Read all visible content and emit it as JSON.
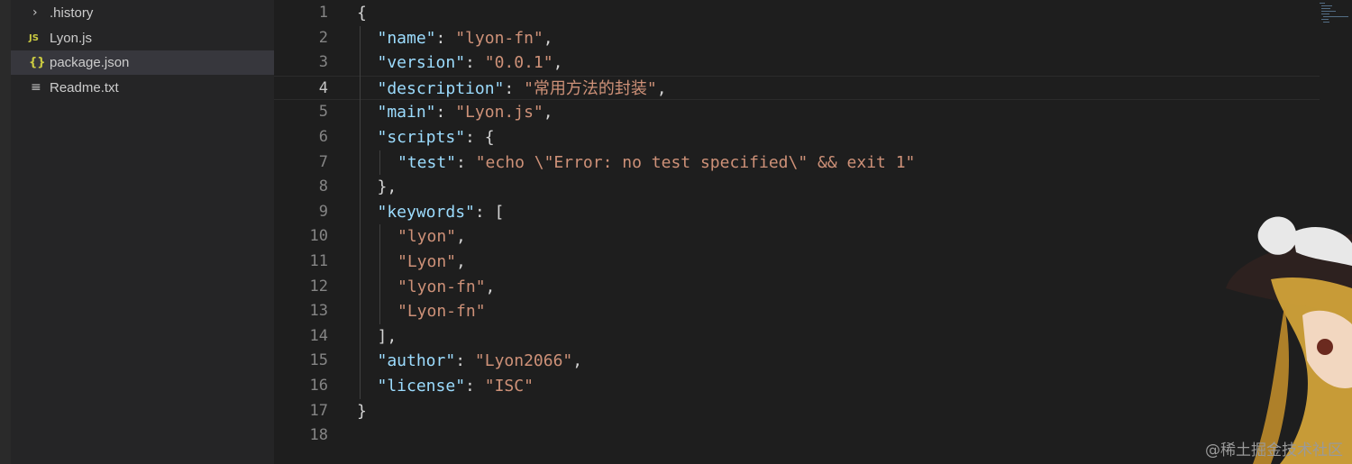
{
  "explorer": {
    "items": [
      {
        "label": ".history",
        "icon": "chevron-right-icon"
      },
      {
        "label": "Lyon.js",
        "icon": "javascript-file-icon",
        "badge": "JS"
      },
      {
        "label": "package.json",
        "icon": "json-file-icon",
        "badge": "{}"
      },
      {
        "label": "Readme.txt",
        "icon": "text-file-icon",
        "badge": "≡"
      }
    ],
    "selected": "package.json"
  },
  "editor": {
    "language": "json",
    "current_line": 4,
    "line_numbers": [
      "1",
      "2",
      "3",
      "4",
      "5",
      "6",
      "7",
      "8",
      "9",
      "10",
      "11",
      "12",
      "13",
      "14",
      "15",
      "16",
      "17",
      "18"
    ],
    "lines": [
      [
        {
          "t": "p",
          "v": "{"
        }
      ],
      [
        {
          "t": "k",
          "v": "\"name\""
        },
        {
          "t": "p",
          "v": ": "
        },
        {
          "t": "s",
          "v": "\"lyon-fn\""
        },
        {
          "t": "p",
          "v": ","
        }
      ],
      [
        {
          "t": "k",
          "v": "\"version\""
        },
        {
          "t": "p",
          "v": ": "
        },
        {
          "t": "s",
          "v": "\"0.0.1\""
        },
        {
          "t": "p",
          "v": ","
        }
      ],
      [
        {
          "t": "k",
          "v": "\"description\""
        },
        {
          "t": "p",
          "v": ": "
        },
        {
          "t": "s",
          "v": "\"常用方法的封装\""
        },
        {
          "t": "p",
          "v": ","
        }
      ],
      [
        {
          "t": "k",
          "v": "\"main\""
        },
        {
          "t": "p",
          "v": ": "
        },
        {
          "t": "s",
          "v": "\"Lyon.js\""
        },
        {
          "t": "p",
          "v": ","
        }
      ],
      [
        {
          "t": "k",
          "v": "\"scripts\""
        },
        {
          "t": "p",
          "v": ": {"
        }
      ],
      [
        {
          "t": "k",
          "v": "\"test\""
        },
        {
          "t": "p",
          "v": ": "
        },
        {
          "t": "s",
          "v": "\"echo \\\"Error: no test specified\\\" && exit 1\""
        }
      ],
      [
        {
          "t": "p",
          "v": "},"
        }
      ],
      [
        {
          "t": "k",
          "v": "\"keywords\""
        },
        {
          "t": "p",
          "v": ": ["
        }
      ],
      [
        {
          "t": "s",
          "v": "\"lyon\""
        },
        {
          "t": "p",
          "v": ","
        }
      ],
      [
        {
          "t": "s",
          "v": "\"Lyon\""
        },
        {
          "t": "p",
          "v": ","
        }
      ],
      [
        {
          "t": "s",
          "v": "\"lyon-fn\""
        },
        {
          "t": "p",
          "v": ","
        }
      ],
      [
        {
          "t": "s",
          "v": "\"Lyon-fn\""
        }
      ],
      [
        {
          "t": "p",
          "v": "],"
        }
      ],
      [
        {
          "t": "k",
          "v": "\"author\""
        },
        {
          "t": "p",
          "v": ": "
        },
        {
          "t": "s",
          "v": "\"Lyon2066\""
        },
        {
          "t": "p",
          "v": ","
        }
      ],
      [
        {
          "t": "k",
          "v": "\"license\""
        },
        {
          "t": "p",
          "v": ": "
        },
        {
          "t": "s",
          "v": "\"ISC\""
        }
      ],
      [
        {
          "t": "p",
          "v": "}"
        }
      ],
      []
    ],
    "indents": [
      0,
      1,
      1,
      1,
      1,
      1,
      2,
      1,
      1,
      2,
      2,
      2,
      2,
      1,
      1,
      1,
      0,
      0
    ]
  },
  "colors": {
    "key": "#9cdcfe",
    "string": "#ce9178",
    "punctuation": "#d4d4d4",
    "background": "#1e1e1e",
    "sidebar": "#252526"
  },
  "watermark": "@稀土掘金技术社区"
}
